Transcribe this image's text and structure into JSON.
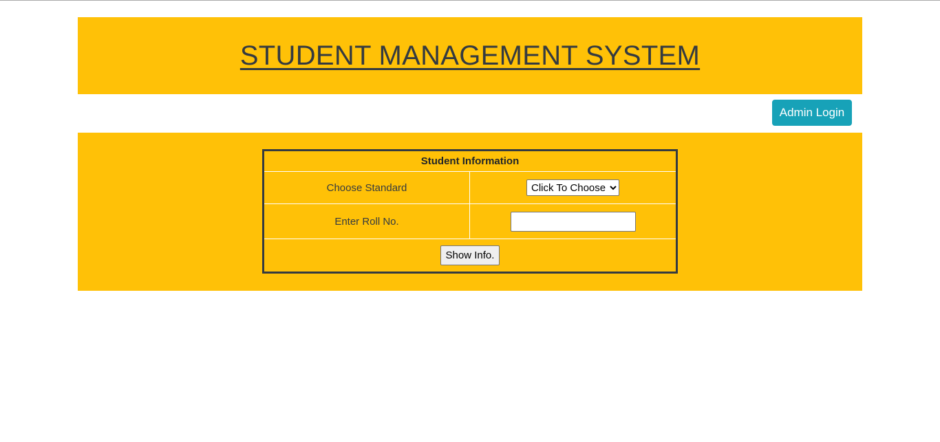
{
  "header": {
    "title": "STUDENT MANAGEMENT SYSTEM"
  },
  "nav": {
    "admin_login_label": "Admin Login"
  },
  "form": {
    "section_title": "Student Information",
    "standard_label": "Choose Standard",
    "standard_select": {
      "selected": "Click To Choose",
      "options": [
        "Click To Choose"
      ]
    },
    "roll_label": "Enter Roll No.",
    "roll_value": "",
    "submit_label": "Show Info."
  },
  "colors": {
    "band": "#ffc107",
    "button": "#17a2b8",
    "text": "#343a40",
    "border": "#343a40"
  }
}
